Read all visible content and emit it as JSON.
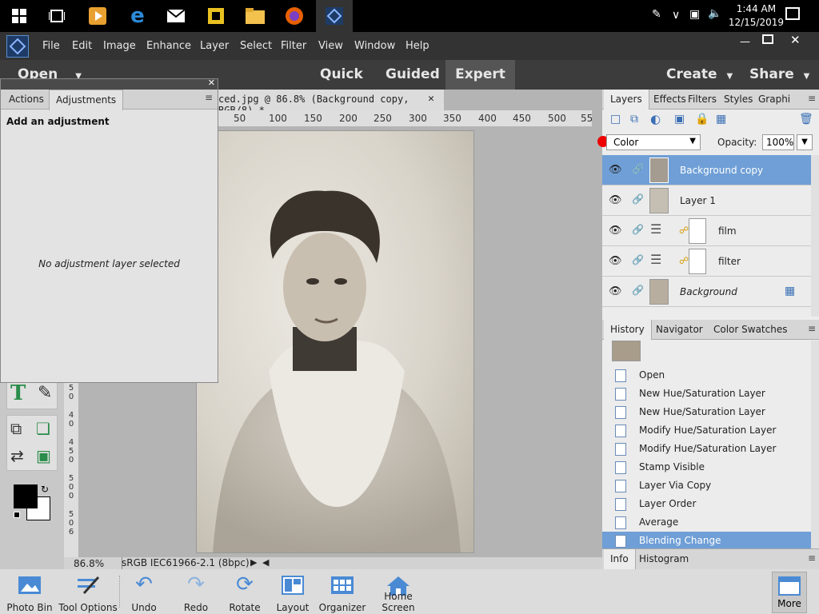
{
  "taskbar": {
    "time": "1:44 AM",
    "date": "12/15/2019",
    "icons": [
      "windows-start-icon",
      "task-view-icon",
      "media-player-icon",
      "edge-icon",
      "mail-icon",
      "puzzle-icon",
      "file-explorer-icon",
      "firefox-icon",
      "elements-icon"
    ]
  },
  "menubar": {
    "items": [
      "File",
      "Edit",
      "Image",
      "Enhance",
      "Layer",
      "Select",
      "Filter",
      "View",
      "Window",
      "Help"
    ]
  },
  "modebar": {
    "open": "Open",
    "quick": "Quick",
    "guided": "Guided",
    "expert": "Expert",
    "create": "Create",
    "share": "Share"
  },
  "document": {
    "tab_title": "ced.jpg @ 86.8% (Background copy, RGB/8) *",
    "ruler_marks": [
      "50",
      "100",
      "150",
      "200",
      "250",
      "300",
      "350",
      "400",
      "450",
      "500",
      "55"
    ],
    "ruler_left": [
      "5",
      "0",
      "4",
      "0",
      "4",
      "5",
      "0",
      "5",
      "0",
      "0",
      "5",
      "0",
      "6"
    ],
    "zoom": "86.8%",
    "color_profile": "sRGB IEC61966-2.1 (8bpc)"
  },
  "adjustments": {
    "tab_actions": "Actions",
    "tab_adjustments": "Adjustments",
    "heading": "Add an adjustment",
    "empty_message": "No adjustment layer selected"
  },
  "layers_panel": {
    "tabs": [
      "Layers",
      "Effects",
      "Filters",
      "Styles",
      "Graphi"
    ],
    "blend_mode": "Color",
    "opacity_label": "Opacity:",
    "opacity_value": "100%",
    "layers": [
      {
        "name": "Background copy",
        "selected": true
      },
      {
        "name": "Layer 1",
        "selected": false
      },
      {
        "name": "film",
        "selected": false
      },
      {
        "name": "filter",
        "selected": false
      },
      {
        "name": "Background",
        "selected": false
      }
    ]
  },
  "history_panel": {
    "tabs": [
      "History",
      "Navigator",
      "Color Swatches"
    ],
    "items": [
      "Open",
      "New Hue/Saturation Layer",
      "New Hue/Saturation Layer",
      "Modify Hue/Saturation Layer",
      "Modify Hue/Saturation Layer",
      "Stamp Visible",
      "Layer Via Copy",
      "Layer Order",
      "Average",
      "Blending Change"
    ]
  },
  "info_panel": {
    "tabs": [
      "Info",
      "Histogram"
    ]
  },
  "bottombar": {
    "items": [
      "Photo Bin",
      "Tool Options",
      "Undo",
      "Redo",
      "Rotate",
      "Layout",
      "Organizer",
      "Home Screen"
    ],
    "more": "More"
  },
  "colors": {
    "accent": "#5b8fcf",
    "selected_row": "#6f9fd6",
    "expert_active": "#555555"
  }
}
